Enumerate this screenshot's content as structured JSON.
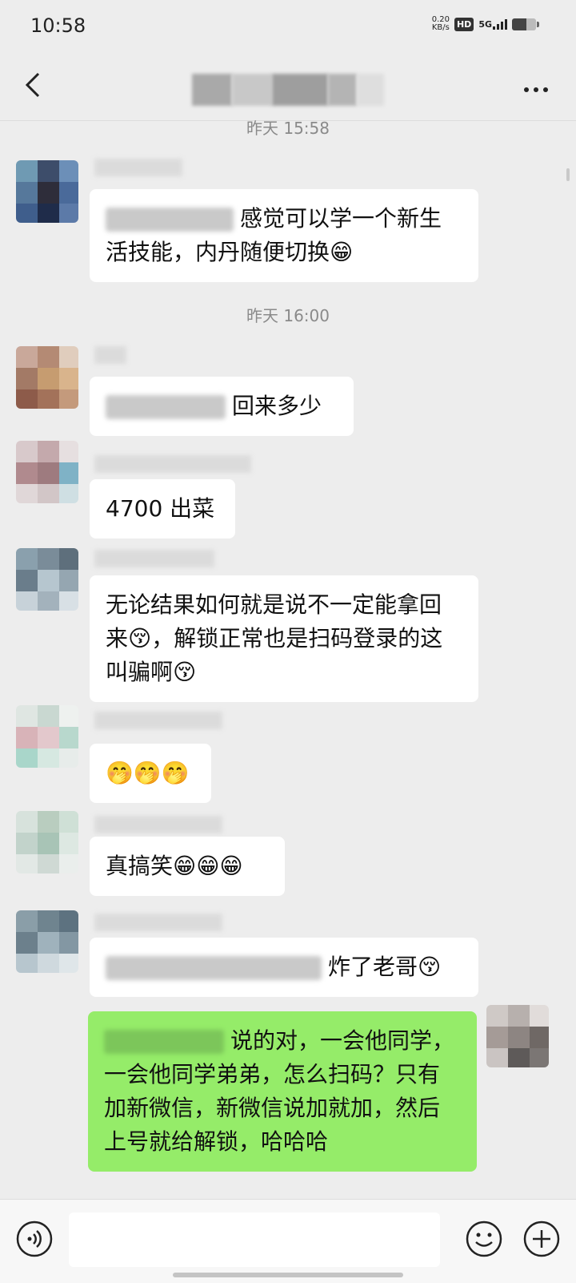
{
  "status_bar": {
    "time": "10:58",
    "net_speed_value": "0.20",
    "net_speed_unit": "KB/s",
    "hd_label": "HD",
    "network_label": "5G"
  },
  "header": {
    "back_icon": "back-arrow-icon",
    "more_icon": "more-dots-icon"
  },
  "chat": {
    "timestamps": [
      "昨天 15:58",
      "昨天 16:00"
    ],
    "messages": [
      {
        "text": "感觉可以学一个新生活技能，内丹随便切换",
        "emoji": "😁"
      },
      {
        "text": "回来多少"
      },
      {
        "text": "4700 出菜"
      },
      {
        "text": "无论结果如何就是说不一定能拿回来😚，解锁正常也是扫码登录的这叫骗啊😚"
      },
      {
        "text": "🤭🤭🤭"
      },
      {
        "text": "真搞笑😁😁😁"
      },
      {
        "text": "炸了老哥😚"
      },
      {
        "text": "说的对，一会他同学，一会他同学弟弟，怎么扫码？只有加新微信，新微信说加就加，然后上号就给解锁，哈哈哈"
      }
    ]
  },
  "input_bar": {
    "placeholder": "",
    "voice_icon": "voice-icon",
    "emoji_icon": "emoji-face-icon",
    "plus_icon": "plus-icon"
  },
  "colors": {
    "background": "#ededed",
    "self_bubble": "#95ec69",
    "other_bubble": "#ffffff"
  }
}
